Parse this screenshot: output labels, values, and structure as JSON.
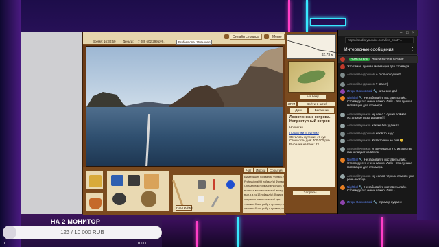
{
  "game": {
    "top_bar": {
      "date_label": "Время:",
      "time_value": "16:30:59",
      "money_label": "Деньги:",
      "money_value": "7 089 602.299 руб.",
      "subscription": "Professional 15 вышел",
      "online_services": "Онлайн сервисы",
      "menu": "Меню"
    },
    "map": {
      "scale": "32.73 м"
    },
    "buttons": {
      "to_base": "На базу",
      "lpm": "ЛПМ",
      "go_to_fine": "Войти в штаб",
      "house": "Дом",
      "luggage": "Багажник",
      "prohibited": "Запреты..."
    },
    "location": {
      "title": "Лофотенские острова. Непреступный остров",
      "subtitle": "Норвегия",
      "link": "Продолжить путевку",
      "lines": [
        "Осталось путевки: 47 сут.",
        "Стоимость дня: 400 000 руб.",
        "Рыбалка на базе: 23"
      ]
    },
    "bottom": {
      "tabs": [
        "Чат",
        "Игроки",
        "События"
      ],
      "rig_label": "Настройки",
      "log_lines": [
        "Бурденишин поймал(а) Фонарь на 4820.996 кг",
        "Professional 99 поймал(а) Фонарь на 3982.676 кг",
        "Обладатель поймал(а) Фонарь на 1392.389 кг",
        "выиграл в своем счастье! выигр",
        "выл.в.в.т.к.13 поймал(а) Фонарь на 1373.437 кг",
        "» путевки нового счастье! рун",
        "» можно было рыбу с путевки, но ...",
        "» можно было рыбу с путевки, но ..."
      ]
    }
  },
  "chat": {
    "url": "https://studio.youtube.com/live_chat?...",
    "header": "Интересные сообщения",
    "menu_icon": "more-vert-icon",
    "pinned": {
      "author": "Аристотель",
      "text": "Ждем мачи в начале"
    },
    "messages": [
      {
        "author": "",
        "author_mod": false,
        "text": "Это самая лучшая мотивация для стримера.",
        "avatar": "#c0392b"
      },
      {
        "author": "Алексей Индюшков",
        "author_mod": false,
        "text": "А сколько сушке?",
        "avatar": "#7f8c8d"
      },
      {
        "author": "Алексей Индюшков",
        "author_mod": false,
        "text": "? (вагит)",
        "avatar": "#7f8c8d"
      },
      {
        "author": "Игорь Ольховский 🔧",
        "author_mod": true,
        "text": "каты мне дай",
        "avatar": "#8e44ad"
      },
      {
        "author": "Nightkel 🔧",
        "author_mod": true,
        "text": "Не забывайте поставить лайк. Стримеру это очень важно. Лайк - Это лучшая мотивация для стримера.",
        "avatar": "#e67e22"
      },
      {
        "author": "Алексей Кульков",
        "author_mod": false,
        "text": "ну все с 1 сушки поймал остальные разыгрываем(((",
        "avatar": "#95a5a6"
      },
      {
        "author": "Алексей Кульков",
        "author_mod": false,
        "text": "как же без удачи то",
        "avatar": "#95a5a6"
      },
      {
        "author": "Алексей Индюшков",
        "author_mod": false,
        "text": "клюв то надо",
        "avatar": "#7f8c8d"
      },
      {
        "author": "Алексей Кульков",
        "author_mod": false,
        "text": "Кита только не лов 😀",
        "avatar": "#95a5a6"
      },
      {
        "author": "Алексей Кульков",
        "author_mod": false,
        "text": "я досчевался что из золотых гавно падает на 10лям",
        "avatar": "#95a5a6"
      },
      {
        "author": "Nightkel 🔧",
        "author_mod": true,
        "text": "Не забывайте поставить лайк. Стримеру это очень важно. Лайк - Это лучшая мотивация для стримера.",
        "avatar": "#e67e22"
      },
      {
        "author": "Алексей Кульков",
        "author_mod": false,
        "text": "ну если в чёрных лям это уже речь-вообще",
        "avatar": "#95a5a6"
      },
      {
        "author": "Nightkel 🔧",
        "author_mod": true,
        "text": "Не забывайте поставить лайк. Стримеру это очень важно. Лайк -",
        "avatar": "#e67e22"
      },
      {
        "author": "Игорь Ольховский 🔧",
        "author_mod": true,
        "text": "стример вуд мне",
        "avatar": "#8e44ad"
      }
    ]
  },
  "donation": {
    "title": "НА 2 МОНИТОР",
    "progress_text": "123 / 10 000 RUB",
    "progress_fraction": 0.0123,
    "min_label": "0",
    "max_label": "10 000"
  }
}
